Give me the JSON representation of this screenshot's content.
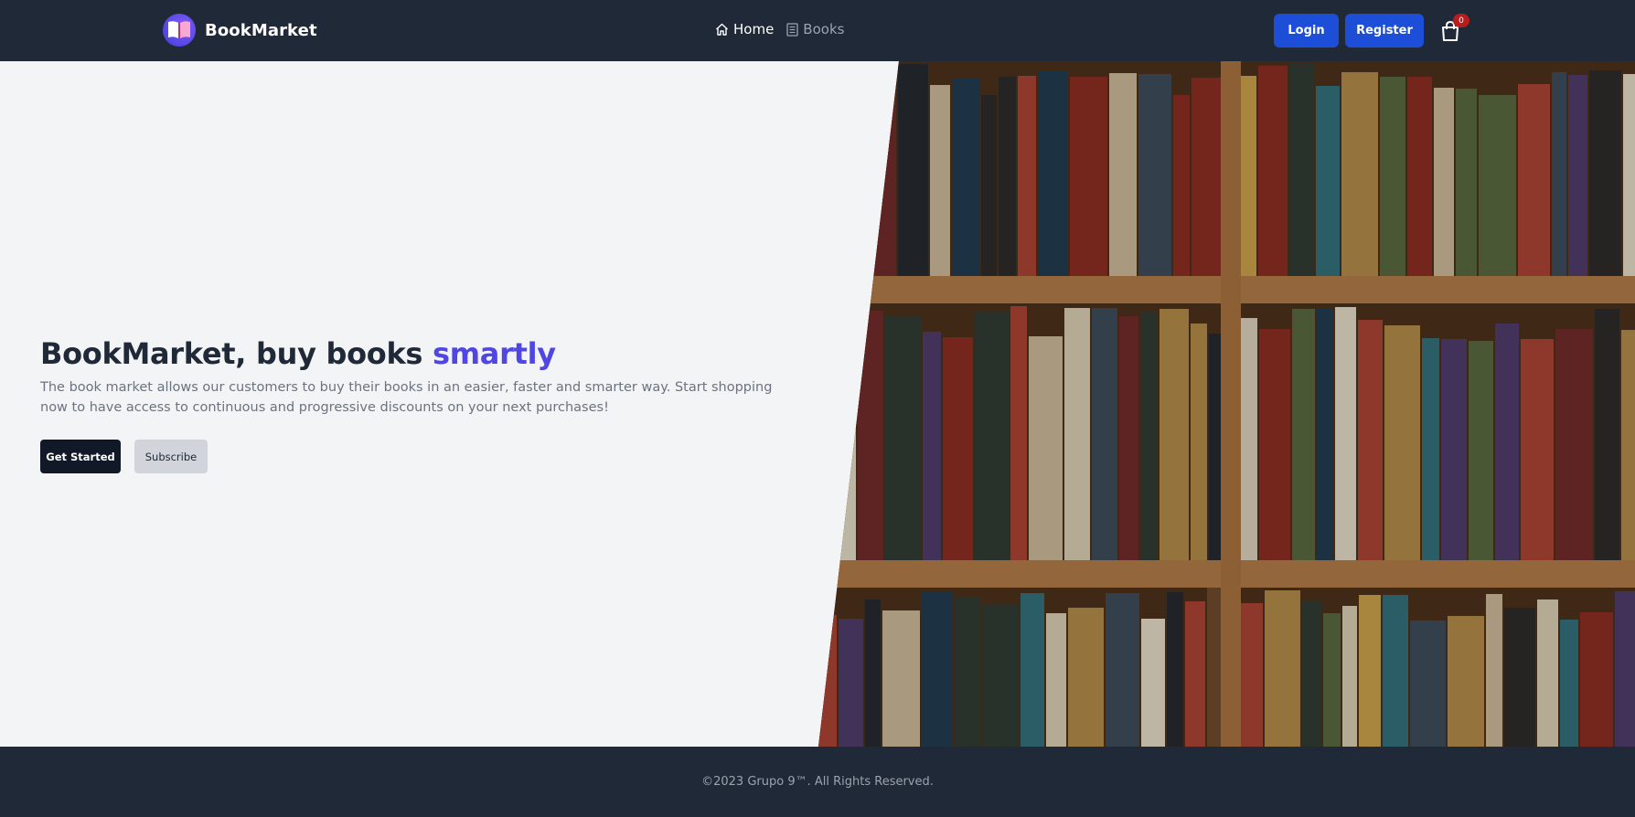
{
  "navbar": {
    "brand_name": "BookMarket",
    "brand_icon": "open-book-icon",
    "links": [
      {
        "label": "Home",
        "icon": "home-icon",
        "active": true
      },
      {
        "label": "Books",
        "icon": "book-list-icon",
        "active": false
      }
    ],
    "login_label": "Login",
    "register_label": "Register",
    "cart_icon": "shopping-bag-icon",
    "cart_count": "0"
  },
  "hero": {
    "title_main": "BookMarket, buy books ",
    "title_accent": "smartly",
    "description": "The book market allows our customers to buy their books in an easier, faster and smarter way. Start shopping now to have access to continuous and progressive discounts on your next purchases!",
    "get_started_label": "Get Started",
    "subscribe_label": "Subscribe",
    "image_subject": "bookshelf photo"
  },
  "footer": {
    "copyright": "©2023 Grupo 9™. All Rights Reserved."
  },
  "colors": {
    "navbar_bg": "#1f2937",
    "hero_bg": "#f3f4f6",
    "accent": "#4f46e5",
    "primary_button": "#1d4ed8",
    "badge": "#b91c1c"
  }
}
